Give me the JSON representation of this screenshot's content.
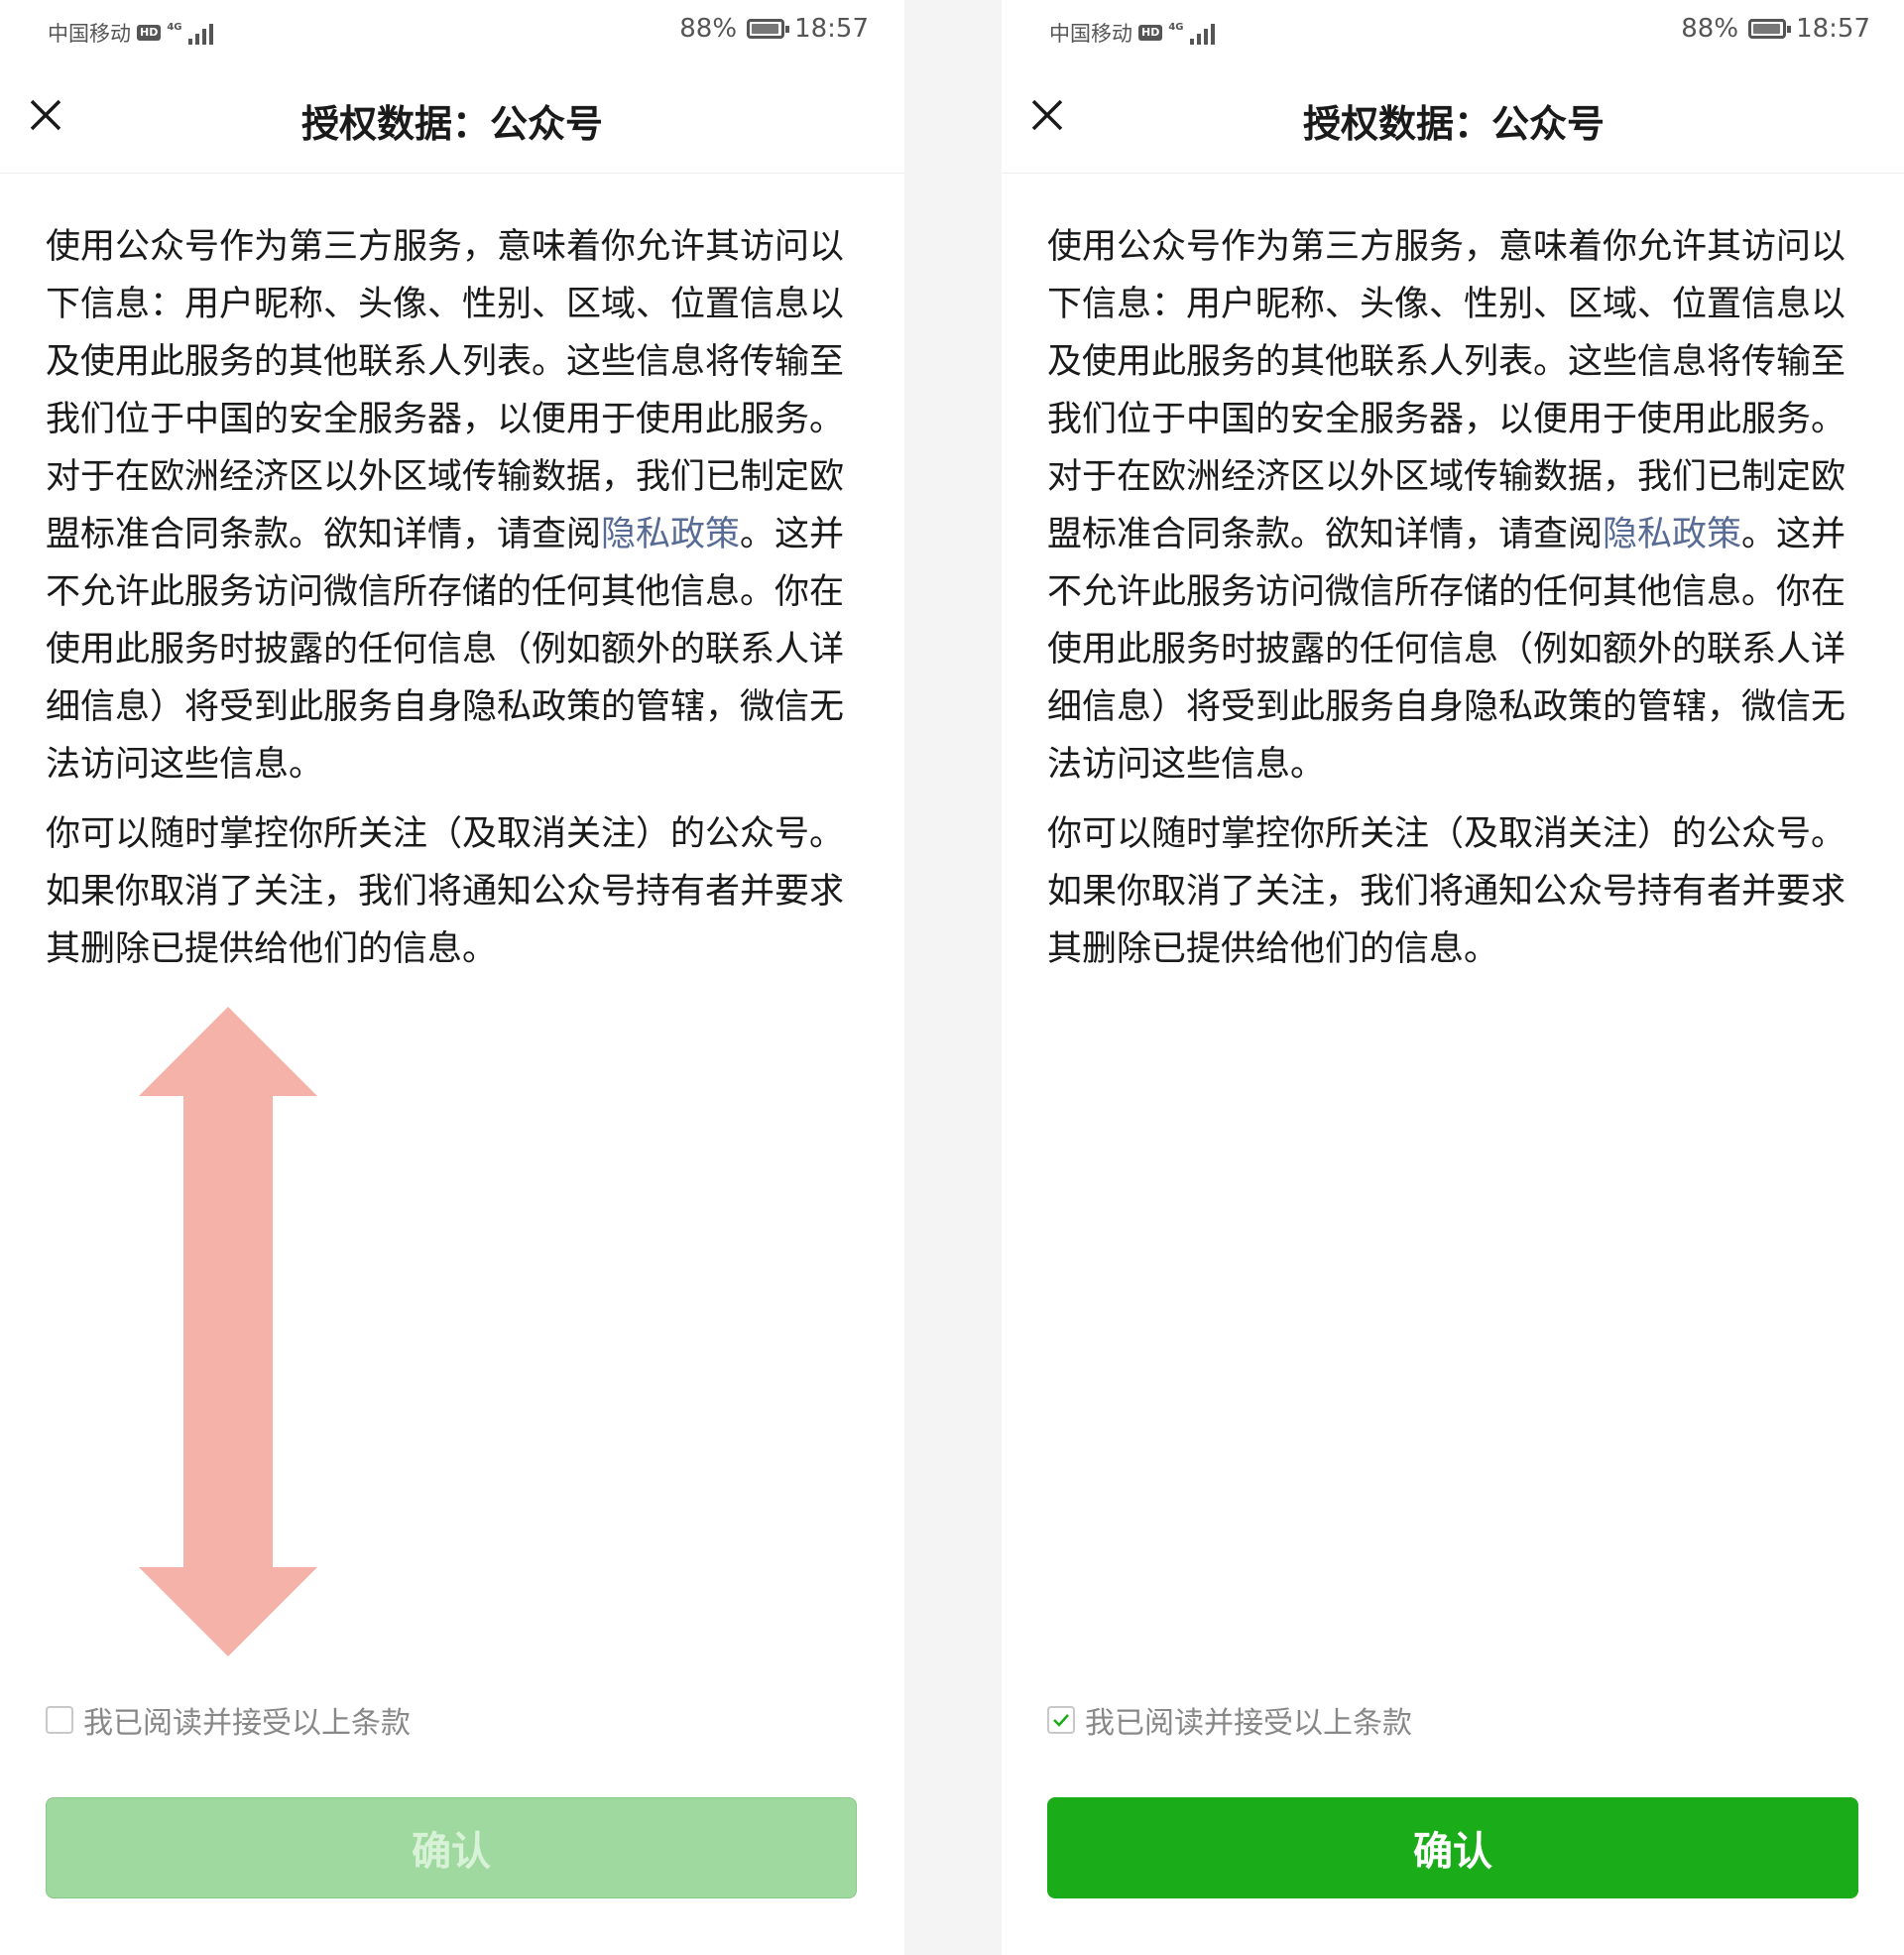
{
  "status_bar": {
    "carrier": "中国移动",
    "hd": "HD",
    "network": "4G",
    "battery": "88%",
    "time": "18:57"
  },
  "header": {
    "title": "授权数据：公众号"
  },
  "content": {
    "para1_before_link": "使用公众号作为第三方服务，意味着你允许其访问以下信息：用户昵称、头像、性别、区域、位置信息以及使用此服务的其他联系人列表。这些信息将传输至我们位于中国的安全服务器，以便用于使用此服务。对于在欧洲经济区以外区域传输数据，我们已制定欧盟标准合同条款。欲知详情，请查阅",
    "link_text": "隐私政策",
    "para1_after_link": "。这并不允许此服务访问微信所存储的任何其他信息。你在使用此服务时披露的任何信息（例如额外的联系人详细信息）将受到此服务自身隐私政策的管辖，微信无法访问这些信息。",
    "para2": "你可以随时掌控你所关注（及取消关注）的公众号。如果你取消了关注，我们将通知公众号持有者并要求其删除已提供给他们的信息。"
  },
  "agreement": {
    "label": "我已阅读并接受以上条款"
  },
  "confirm_button": {
    "label": "确认"
  },
  "states": {
    "left": {
      "checked": false,
      "button_enabled": false
    },
    "right": {
      "checked": true,
      "button_enabled": true
    }
  },
  "colors": {
    "brand_green": "#1aad19",
    "disabled_green": "#9fd99f",
    "link_blue": "#576b95",
    "arrow_pink": "#f4b2a8"
  },
  "icons": {
    "close": "close-icon",
    "checkbox": "checkbox-icon",
    "check": "checkmark-icon",
    "scroll_hint": "double-arrow-icon"
  }
}
